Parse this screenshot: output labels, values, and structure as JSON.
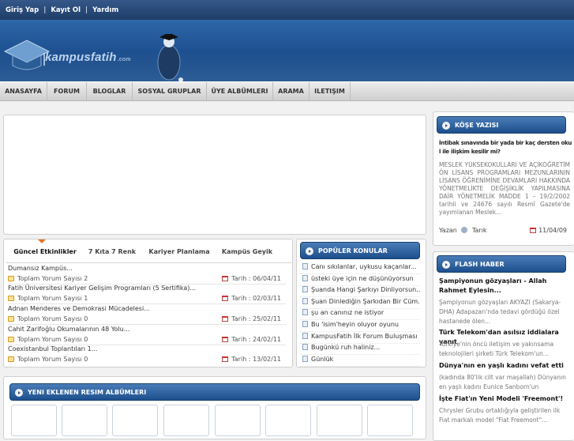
{
  "topbar": {
    "login": "Giriş Yap",
    "sep": "|",
    "register": "Kayıt Ol",
    "help": "Yardım"
  },
  "logo": {
    "text": "kampusfatih",
    "suffix": ".com"
  },
  "nav": [
    "ANASAYFA",
    "FORUM",
    "BLOGLAR",
    "SOSYAL GRUPLAR",
    "ÜYE ALBÜMLERI",
    "ARAMA",
    "ILETIŞIM"
  ],
  "tabs": [
    "Güncel Etkinlikler",
    "7 Kıta 7 Renk",
    "Kariyer Planlama",
    "Kampüs Geyik"
  ],
  "news_comment_label": "Toplam Yorum Sayısı",
  "news_date_label": "Tarih :",
  "news": [
    {
      "title": "Dumansız Kampüs...",
      "comments": "2",
      "date": "06/04/11"
    },
    {
      "title": "Fatih Üniversitesi Kariyer Gelişim Programları (5 Sertifika)...",
      "comments": "1",
      "date": "02/03/11"
    },
    {
      "title": "Adnan Menderes ve Demokrasi Mücadelesi...",
      "comments": "0",
      "date": "25/02/11"
    },
    {
      "title": "Cahit Zarifoğlu Okumalarının 48 Yolu...",
      "comments": "0",
      "date": "24/02/11"
    },
    {
      "title": "Coexistanbul Toplantıları 1...",
      "comments": "0",
      "date": "13/02/11"
    }
  ],
  "popular": {
    "title": "POPÜLER KONULAR",
    "items": [
      "Canı sıkılanlar, uykusu kaçanlar...",
      "üsteki üye için ne düşünüyorsun",
      "Şuanda Hangi Şarkıyı Dinliyorsun...",
      "Şuan Dinlediğin Şarkıdan Bir Cüm...",
      "şu an canınız ne istiyor",
      "Bu 'isim'heyin oluyor oyunu",
      "KampusFatih İlk Forum Buluşması",
      "Bugünkü ruh haliniz...",
      "Günlük"
    ]
  },
  "albums": {
    "title": "YENI EKLENEN RESIM ALBÜMLERI"
  },
  "column": {
    "title": "KÖŞE YAZISI",
    "headline": "İntibak sınavında bir yada bir kaç dersten okul ile ilişkim kesilir mi?",
    "body": "MESLEK YÜKSEKOKULLARI VE AÇIKÖĞRETİM ÖN LİSANS PROGRAMLARI MEZUNLARININ LİSANS ÖĞRENİMİNE DEVAMLARI HAKKINDA YÖNETMELİKTE DEĞİŞİKLİK YAPILMASINA DAİR YÖNETMELİK MADDE 1 – 19/2/2002 tarihli ve 24676 sayılı Resmî Gazete'de yayımlanan Meslek...",
    "author_label": "Yazan",
    "author": "Tarık",
    "date": "11/04/09"
  },
  "flash": {
    "title": "FLASH HABER",
    "items": [
      {
        "title": "Şampiyonun gözyaşları - Allah Rahmet Eylesin...",
        "body": "Şampiyonun gözyaşları AKYAZI (Sakarya-DHA) Adapazarı'nda tedavi gördüğü özel hastanede ölen..."
      },
      {
        "title": "Türk Telekom'dan asılsız iddialara yanıt",
        "body": "Türkiye'nin öncü iletişim ve yakınsama teknolojileri şirketi Türk Telekom'un..."
      },
      {
        "title": "Dünya'nın en yaşlı kadını vefat etti",
        "body": "(kadında 80'lik cilt var maşallah) Dünyanın en yaşlı kadını Eunice Sanborn'un ABD'nin..."
      },
      {
        "title": "İşte Fiat'ın Yeni Modeli 'Freemont'!",
        "body": "Chrysler Grubu ortaklığıyla geliştirilen ilk Fiat markalı model \"Fiat Freemont\"..."
      }
    ]
  },
  "colors": {
    "brand": "#1d4f8c",
    "accent": "#e8732a"
  }
}
